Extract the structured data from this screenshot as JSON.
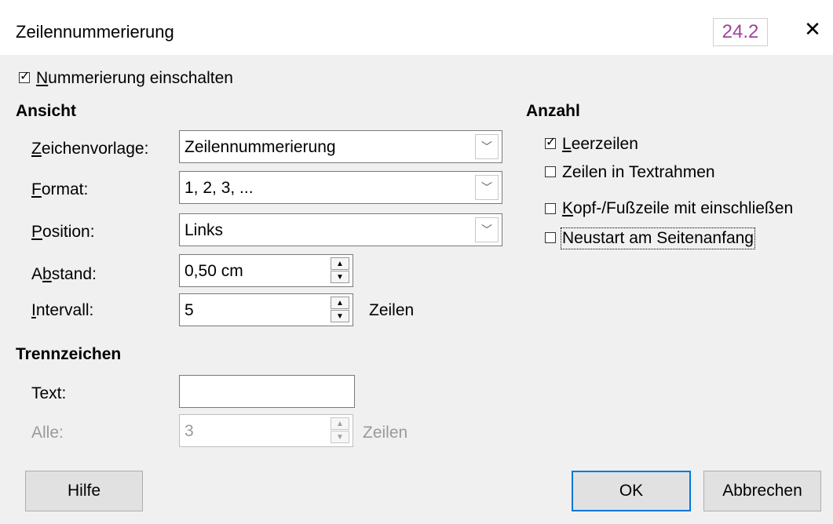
{
  "window": {
    "title": "Zeilennummerierung",
    "version": "24.2",
    "close": "✕"
  },
  "enable_numbering": {
    "label": "Nummerierung einschalten",
    "checked": true
  },
  "view": {
    "header": "Ansicht",
    "char_style": {
      "label": "Zeichenvorlage:",
      "value": "Zeilennummerierung"
    },
    "format": {
      "label": "Format:",
      "value": "1, 2, 3, ..."
    },
    "position": {
      "label": "Position:",
      "value": "Links"
    },
    "spacing": {
      "label": "Abstand:",
      "value": "0,50 cm"
    },
    "interval": {
      "label": "Intervall:",
      "value": "5",
      "unit": "Zeilen"
    }
  },
  "count": {
    "header": "Anzahl",
    "blank_lines": {
      "label": "Leerzeilen",
      "checked": true
    },
    "text_frames": {
      "label": "Zeilen in Textrahmen",
      "checked": false
    },
    "header_footer": {
      "label": "Kopf-/Fußzeile mit einschließen",
      "checked": false
    },
    "restart": {
      "label": "Neustart am Seitenanfang",
      "checked": false
    }
  },
  "separator": {
    "header": "Trennzeichen",
    "text": {
      "label": "Text:",
      "value": ""
    },
    "every": {
      "label": "Alle:",
      "value": "3",
      "unit": "Zeilen"
    }
  },
  "buttons": {
    "help": "Hilfe",
    "ok": "OK",
    "cancel": "Abbrechen"
  }
}
